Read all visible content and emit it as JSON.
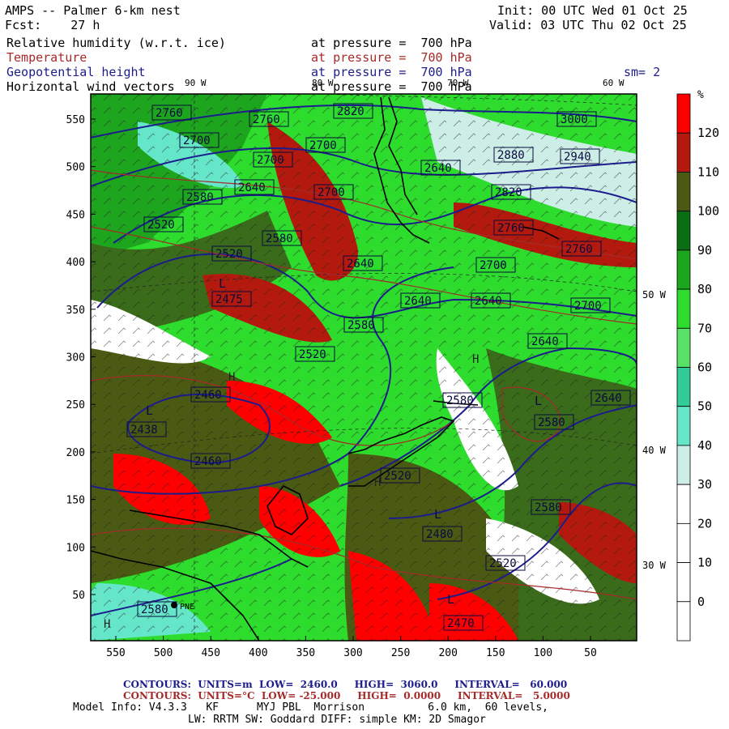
{
  "header": {
    "title": "AMPS -- Palmer 6-km nest",
    "fcst_label": "Fcst:",
    "fcst_value": "27 h",
    "init": "Init: 00 UTC Wed 01 Oct 25",
    "valid": "Valid: 03 UTC Thu 02 Oct 25",
    "sm": "sm= 2",
    "fields": [
      {
        "name": "Relative humidity (w.r.t. ice)",
        "level": "at pressure =  700 hPa",
        "color": "#000000"
      },
      {
        "name": "Temperature",
        "level": "at pressure =  700 hPa",
        "color": "#a52a2a"
      },
      {
        "name": "Geopotential height",
        "level": "at pressure =  700 hPa",
        "color": "#1c1c8c"
      },
      {
        "name": "Horizontal wind vectors",
        "level": "at pressure =  700 hPa",
        "color": "#000000"
      }
    ]
  },
  "map": {
    "y_ticks": [
      "550",
      "500",
      "450",
      "400",
      "350",
      "300",
      "250",
      "200",
      "150",
      "100",
      "50"
    ],
    "x_ticks": [
      "550",
      "500",
      "450",
      "400",
      "350",
      "300",
      "250",
      "200",
      "150",
      "100",
      "50"
    ],
    "top_lon_labels": [
      "90 W",
      "80 W",
      "70 W",
      "60 W"
    ],
    "right_lon_labels": [
      "50 W",
      "40 W",
      "30 W"
    ],
    "station_label": "PNE",
    "height_labels": [
      "2760",
      "2760",
      "2820",
      "3000",
      "2700",
      "2700",
      "2880",
      "2940",
      "2700",
      "2640",
      "2700",
      "2820",
      "2580",
      "2640",
      "2580",
      "2760",
      "2520",
      "2640",
      "2700",
      "2760",
      "2520",
      "2475",
      "2640",
      "2640",
      "2700",
      "2580",
      "2520",
      "2640",
      "2460",
      "2580",
      "2640",
      "2438",
      "2580",
      "2460",
      "2520",
      "2580",
      "2480",
      "2520",
      "2580",
      "2470"
    ],
    "low_markers": [
      "L",
      "L",
      "L",
      "L",
      "L"
    ],
    "high_markers": [
      "H",
      "H",
      "H",
      "H"
    ]
  },
  "colorbar": {
    "unit": "%",
    "labels": [
      "120",
      "110",
      "100",
      "90",
      "80",
      "70",
      "60",
      "50",
      "40",
      "30",
      "20",
      "10",
      "0"
    ],
    "colors": [
      "#ff0000",
      "#b31a0d",
      "#4b5a12",
      "#0a6e14",
      "#1ea51e",
      "#2ddc2d",
      "#59e066",
      "#33cc99",
      "#66e6c8",
      "#cceee6",
      "#ffffff",
      "#ffffff",
      "#ffffff",
      "#ffffff"
    ]
  },
  "footer": {
    "contours1": "CONTOURS:  UNITS=m  LOW=  2460.0     HIGH=  3060.0     INTERVAL=   60.000",
    "contours2": "CONTOURS:  UNITS=°C  LOW= -25.000     HIGH=  0.0000     INTERVAL=   5.0000",
    "model_info": "Model Info: V4.3.3   KF      MYJ PBL  Morrison          6.0 km,  60 levels,",
    "model_info2": "LW: RRTM SW: Goddard DIFF: simple KM: 2D Smagor"
  }
}
